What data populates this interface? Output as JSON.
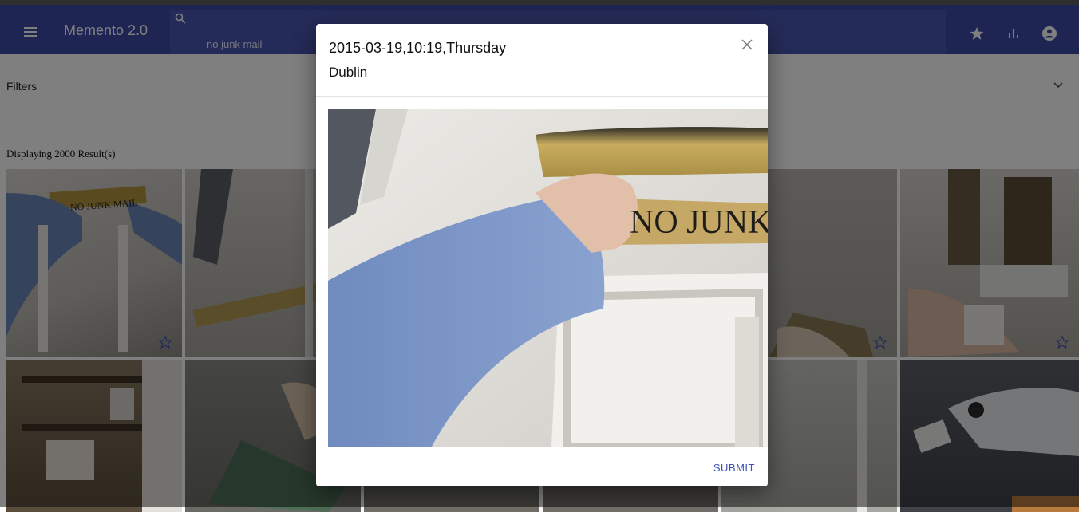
{
  "appbar": {
    "title": "Memento 2.0",
    "menu_icon": "hamburger-menu-icon",
    "search_icon": "search-icon",
    "search_value": "no junk mail",
    "icons": [
      "star-icon",
      "bar-chart-icon",
      "account-icon"
    ]
  },
  "filters": {
    "label": "Filters",
    "expand_icon": "chevron-down-icon"
  },
  "results": {
    "text": "Displaying 2000 Result(s)"
  },
  "dialog": {
    "title": "2015-03-19,10:19,Thursday",
    "subtitle": "Dublin",
    "close_icon": "close-icon",
    "image_text": "NO JUNK MA",
    "submit_label": "SUBMIT"
  },
  "tiles": [
    {
      "caption": "NO JUNK MAIL",
      "star": true
    },
    {
      "caption": "",
      "star": false
    },
    {
      "caption": "",
      "star": false
    },
    {
      "caption": "",
      "star": false
    },
    {
      "caption": "",
      "star": true
    },
    {
      "caption": "",
      "star": true
    }
  ],
  "colors": {
    "primary": "#3d4aa6",
    "accent": "#3f51b5",
    "overlay": "#000000"
  }
}
